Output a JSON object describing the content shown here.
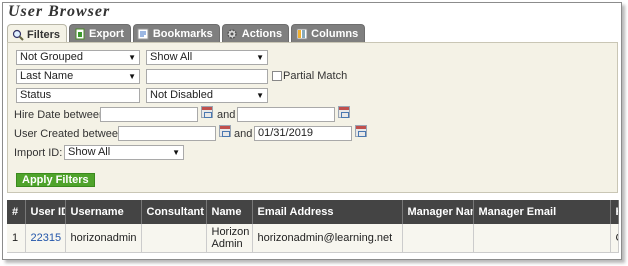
{
  "title": "User Browser",
  "tabs": [
    {
      "label": "Filters",
      "icon": "magnifier-icon"
    },
    {
      "label": "Export",
      "icon": "document-icon"
    },
    {
      "label": "Bookmarks",
      "icon": "bookmark-icon"
    },
    {
      "label": "Actions",
      "icon": "gear-icon"
    },
    {
      "label": "Columns",
      "icon": "columns-icon"
    }
  ],
  "filters": {
    "grouping": "Not Grouped",
    "show": "Show All",
    "field": "Last Name",
    "field_value": "",
    "partial_match_label": "Partial Match",
    "status_label": "Status",
    "status_value": "Not Disabled",
    "hire_date_label": "Hire Date between",
    "hire_from": "",
    "hire_and": "and",
    "hire_to": "",
    "created_label": "User Created between",
    "created_from": "",
    "created_and": "and",
    "created_to": "01/31/2019",
    "import_label": "Import ID:",
    "import_value": "Show All",
    "apply_label": "Apply Filters"
  },
  "table": {
    "headers": [
      "#",
      "User ID",
      "Username",
      "Consultant ID",
      "Name",
      "Email Address",
      "Manager Name",
      "Manager Email",
      "H"
    ],
    "rows": [
      {
        "num": "1",
        "user_id": "22315",
        "username": "horizonadmin",
        "consultant_id": "",
        "name": "Horizon Admin",
        "email": "horizonadmin@learning.net",
        "manager_name": "",
        "manager_email": "",
        "extra": "C"
      }
    ]
  },
  "colors": {
    "tab": "#7f7f7f",
    "panel": "#f4f2e6",
    "apply": "#4fa32b",
    "header": "#444444",
    "link": "#2255aa"
  }
}
